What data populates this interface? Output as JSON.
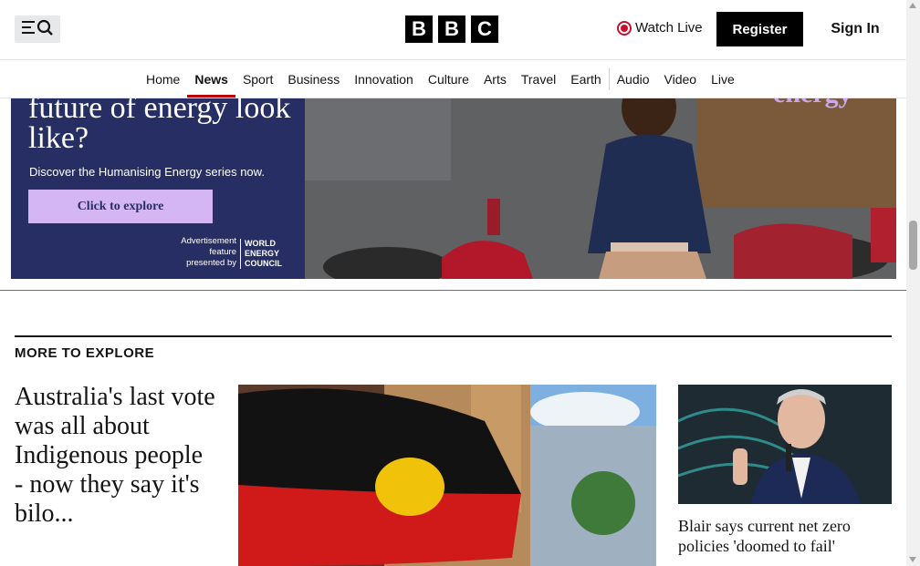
{
  "header": {
    "menu_icon": "menu-search-icon",
    "logo_letters": [
      "B",
      "B",
      "C"
    ],
    "watch_live_label": "Watch Live",
    "register_label": "Register",
    "sign_in_label": "Sign In",
    "live_color": "#c8102e"
  },
  "nav": {
    "items": [
      "Home",
      "News",
      "Sport",
      "Business",
      "Innovation",
      "Culture",
      "Arts",
      "Travel",
      "Earth",
      "Audio",
      "Video",
      "Live"
    ],
    "active": "News",
    "accent_color": "#b80000"
  },
  "ad": {
    "headline": "future of energy look like?",
    "subline": "Discover the Humanising Energy series now.",
    "cta_label": "Click to explore",
    "advertisement_note": "Advertisement feature presented by",
    "sponsor": "WORLD ENERGY COUNCIL",
    "photo_overlay_word": "energy",
    "panel_color": "#262e64",
    "cta_color": "#d4b6f5"
  },
  "more_to_explore": {
    "title": "MORE TO EXPLORE",
    "lead_story": {
      "headline": "Australia's last vote was all about Indigenous people - now they say it's bilo..."
    },
    "side_story": {
      "headline": "Blair says current net zero policies 'doomed to fail'"
    }
  }
}
